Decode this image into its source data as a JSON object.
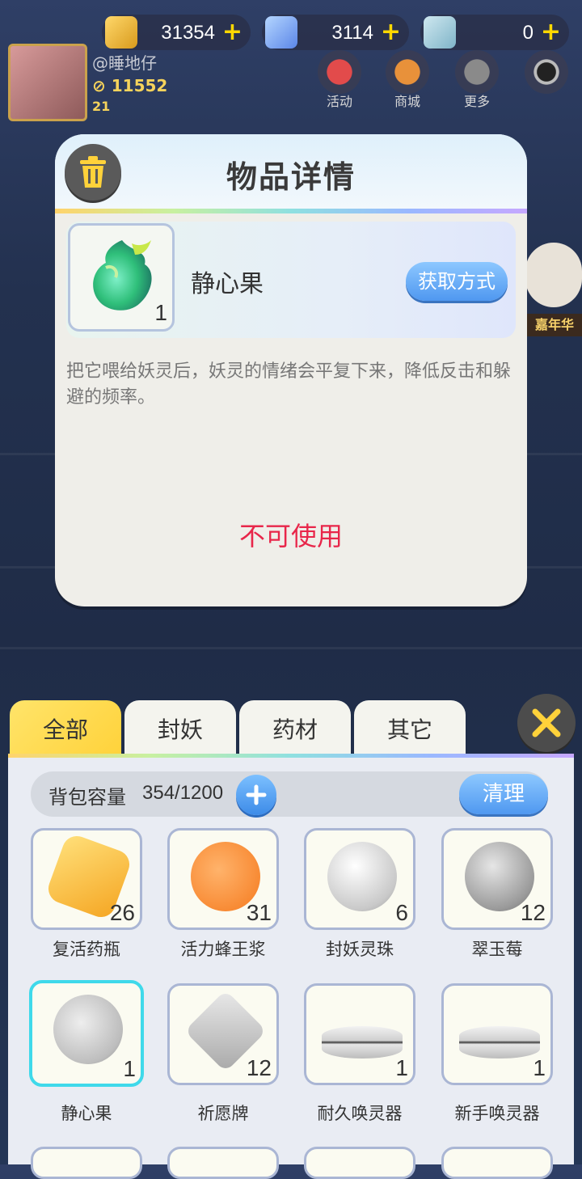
{
  "currencies": [
    {
      "icon": "gold-ingot-icon",
      "value": "31354"
    },
    {
      "icon": "diamond-icon",
      "value": "3114"
    },
    {
      "icon": "ticket-icon",
      "value": "0"
    }
  ],
  "player": {
    "name": "@睡地仔",
    "power": "11552",
    "level": "21"
  },
  "top_menu": [
    {
      "label": "活动",
      "icon": "gift-icon"
    },
    {
      "label": "商城",
      "icon": "shop-icon"
    },
    {
      "label": "更多",
      "icon": "grid-icon"
    }
  ],
  "side_event": {
    "label": "嘉年华"
  },
  "modal": {
    "title": "物品详情",
    "item_name": "静心果",
    "item_qty": "1",
    "get_method_label": "获取方式",
    "description": "把它喂给妖灵后，妖灵的情绪会平复下来，降低反击和躲避的频率。",
    "status_text": "不可使用"
  },
  "bag": {
    "tabs": [
      "全部",
      "封妖",
      "药材",
      "其它"
    ],
    "active_tab": "全部",
    "capacity_label": "背包容量",
    "capacity_value": "354/1200",
    "clean_label": "清理",
    "items": [
      {
        "name": "复活药瓶",
        "qty": "26",
        "icon": "potion-jar-icon",
        "color": "#f5a623"
      },
      {
        "name": "活力蜂王浆",
        "qty": "31",
        "icon": "honey-jar-icon",
        "color": "#f57a1e"
      },
      {
        "name": "封妖灵珠",
        "qty": "6",
        "icon": "yinyang-orb-icon",
        "color": "#d9d9d9"
      },
      {
        "name": "翠玉莓",
        "qty": "12",
        "icon": "berry-icon",
        "color": "#9a9a9a"
      },
      {
        "name": "静心果",
        "qty": "1",
        "icon": "calm-fruit-icon",
        "color": "#bdbdbd"
      },
      {
        "name": "祈愿牌",
        "qty": "12",
        "icon": "wish-plaque-icon",
        "color": "#b8b8b8"
      },
      {
        "name": "耐久唤灵器",
        "qty": "1",
        "icon": "summoner-device-icon",
        "color": "#dcdcdc"
      },
      {
        "name": "新手唤灵器",
        "qty": "1",
        "icon": "summoner-device-icon",
        "color": "#dcdcdc"
      }
    ]
  }
}
